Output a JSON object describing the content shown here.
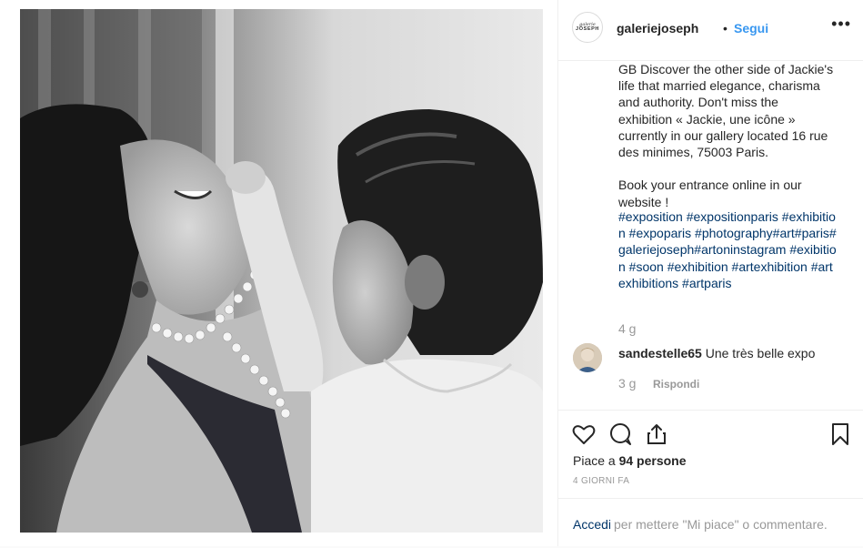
{
  "post": {
    "username": "galeriejoseph",
    "separator": "•",
    "follow_label": "Segui",
    "more_label": "•••",
    "logo_line1": "galerie",
    "logo_line2": "JOSEPH"
  },
  "caption": {
    "text": "GB Discover the other side of Jackie's\nlife that married elegance, charisma\nand authority. Don't miss the\nexhibition « Jackie, une icône »\ncurrently in our gallery located 16 rue\ndes minimes, 75003 Paris.\n\nBook your entrance online in our\nwebsite !",
    "tags": "  #exposition #expositionparis #exhibition #expoparis #photography#art#paris#galeriejoseph#artoninstagram #exibition #soon #exhibition #artexhibition #artexhibitions #artparis",
    "time": "4 g"
  },
  "comment": {
    "username": "sandestelle65",
    "text": "Une très belle expo",
    "time": "3 g",
    "reply_label": "Rispondi"
  },
  "actions": {
    "likes_prefix": "Piace a ",
    "likes_count": "94 persone",
    "time_ago": "4 GIORNI FA",
    "login_link": "Accedi",
    "login_text": "per mettere \"Mi piace\" o commentare."
  }
}
